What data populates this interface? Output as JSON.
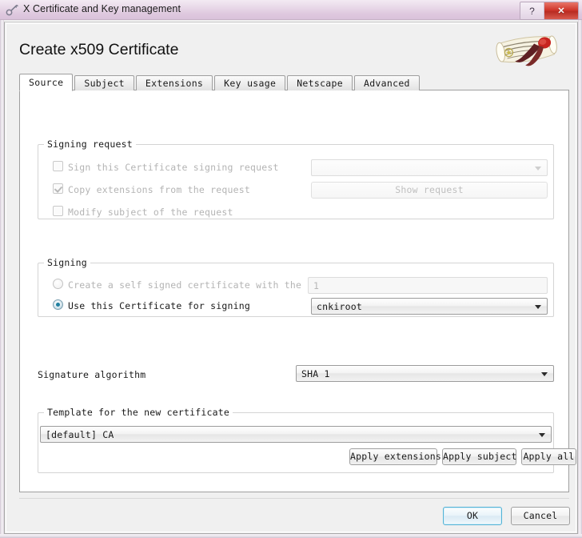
{
  "window": {
    "title": "X Certificate and Key management",
    "app_icon": "key-certificate-icon",
    "help_button": "?",
    "close_button": "✕"
  },
  "heading": "Create x509 Certificate",
  "logo_icon": "certificate-scroll-seal-icon",
  "tabs": [
    {
      "label": "Source",
      "active": true
    },
    {
      "label": "Subject",
      "active": false
    },
    {
      "label": "Extensions",
      "active": false
    },
    {
      "label": "Key usage",
      "active": false
    },
    {
      "label": "Netscape",
      "active": false
    },
    {
      "label": "Advanced",
      "active": false
    }
  ],
  "signing_request": {
    "title": "Signing request",
    "sign_request_label": "Sign this Certificate signing request",
    "sign_request_checked": false,
    "request_combo_value": "",
    "copy_extensions_label": "Copy extensions from the request",
    "copy_extensions_checked": true,
    "show_request_button": "Show request",
    "modify_subject_label": "Modify subject of the request",
    "modify_subject_checked": false
  },
  "signing": {
    "title": "Signing",
    "self_signed_label": "Create a self signed certificate with the serial",
    "self_signed_selected": false,
    "serial_value": "1",
    "use_certificate_label": "Use this Certificate for signing",
    "use_certificate_selected": true,
    "certificate_combo_value": "cnkiroot"
  },
  "signature": {
    "label": "Signature algorithm",
    "value": "SHA 1"
  },
  "template": {
    "title": "Template for the new certificate",
    "value": "[default] CA",
    "apply_extensions_button": "Apply extensions",
    "apply_subject_button": "Apply subject",
    "apply_all_button": "Apply all"
  },
  "dialog_buttons": {
    "ok": "OK",
    "cancel": "Cancel"
  },
  "colors": {
    "titlebar": "#e1d0e2",
    "close_red": "#c9332a",
    "radio_accent": "#1f7fa0",
    "default_button_border": "#53b3d6"
  }
}
